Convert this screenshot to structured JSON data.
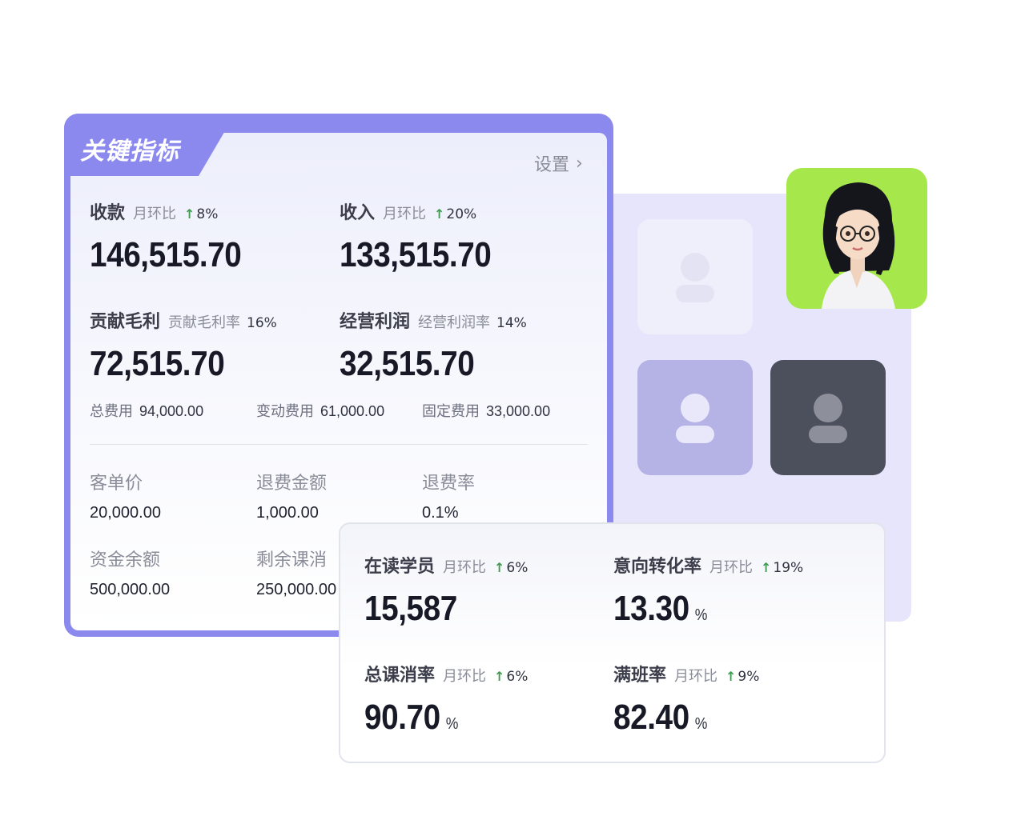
{
  "card": {
    "title": "关键指标",
    "settings_label": "设置",
    "metrics": [
      {
        "name": "收款",
        "sub": "月环比",
        "trend": "8%",
        "value": "146,515.70"
      },
      {
        "name": "收入",
        "sub": "月环比",
        "trend": "20%",
        "value": "133,515.70"
      },
      {
        "name": "贡献毛利",
        "sub": "贡献毛利率",
        "rate": "16%",
        "value": "72,515.70"
      },
      {
        "name": "经营利润",
        "sub": "经营利润率",
        "rate": "14%",
        "value": "32,515.70"
      }
    ],
    "fees": [
      {
        "label": "总费用",
        "value": "94,000.00"
      },
      {
        "label": "变动费用",
        "value": "61,000.00"
      },
      {
        "label": "固定费用",
        "value": "33,000.00"
      }
    ],
    "small_metrics": [
      {
        "label": "客单价",
        "value": "20,000.00"
      },
      {
        "label": "退费金额",
        "value": "1,000.00"
      },
      {
        "label": "退费率",
        "value": "0.1%"
      },
      {
        "label": "资金余额",
        "value": "500,000.00"
      },
      {
        "label": "剩余课消",
        "value": "250,000.00"
      }
    ]
  },
  "overlay": {
    "metrics": [
      {
        "name": "在读学员",
        "sub": "月环比",
        "trend": "6%",
        "value": "15,587",
        "unit": ""
      },
      {
        "name": "意向转化率",
        "sub": "月环比",
        "trend": "19%",
        "value": "13.30",
        "unit": "%"
      },
      {
        "name": "总课消率",
        "sub": "月环比",
        "trend": "6%",
        "value": "90.70",
        "unit": "%"
      },
      {
        "name": "满班率",
        "sub": "月环比",
        "trend": "9%",
        "value": "82.40",
        "unit": "%"
      }
    ]
  },
  "icons": {
    "trend_up": "arrow-up-icon",
    "settings_chevron": "chevron-right-icon",
    "avatar_placeholder": "user-icon"
  },
  "colors": {
    "accent": "#8b88ee",
    "trend_up": "#3f9b4f",
    "photo_bg": "#a6e84b"
  }
}
